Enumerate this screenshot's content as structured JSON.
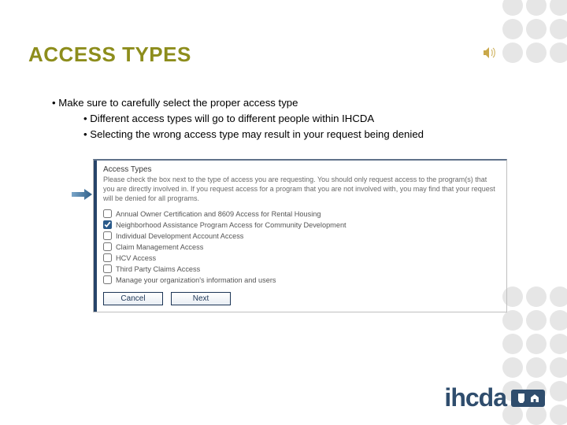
{
  "title": "ACCESS TYPES",
  "bullets": {
    "main": "Make sure to carefully select the proper access type",
    "sub1": "Different access types will go to different people within IHCDA",
    "sub2": "Selecting the wrong access type may result in your request being denied"
  },
  "panel": {
    "section_title": "Access Types",
    "description": "Please check the box next to the type of access you are requesting. You should only request access to the program(s) that you are directly involved in. If you request access for a program that you are not involved with, you may find that your request will be denied for all programs.",
    "options": [
      {
        "label": "Annual Owner Certification and 8609 Access for Rental Housing",
        "checked": false
      },
      {
        "label": "Neighborhood Assistance Program Access for Community Development",
        "checked": true
      },
      {
        "label": "Individual Development Account Access",
        "checked": false
      },
      {
        "label": "Claim Management Access",
        "checked": false
      },
      {
        "label": "HCV Access",
        "checked": false
      },
      {
        "label": "Third Party Claims Access",
        "checked": false
      },
      {
        "label": "Manage your organization's information and users",
        "checked": false
      }
    ],
    "cancel_label": "Cancel",
    "next_label": "Next"
  },
  "logo_text": "ihcda"
}
